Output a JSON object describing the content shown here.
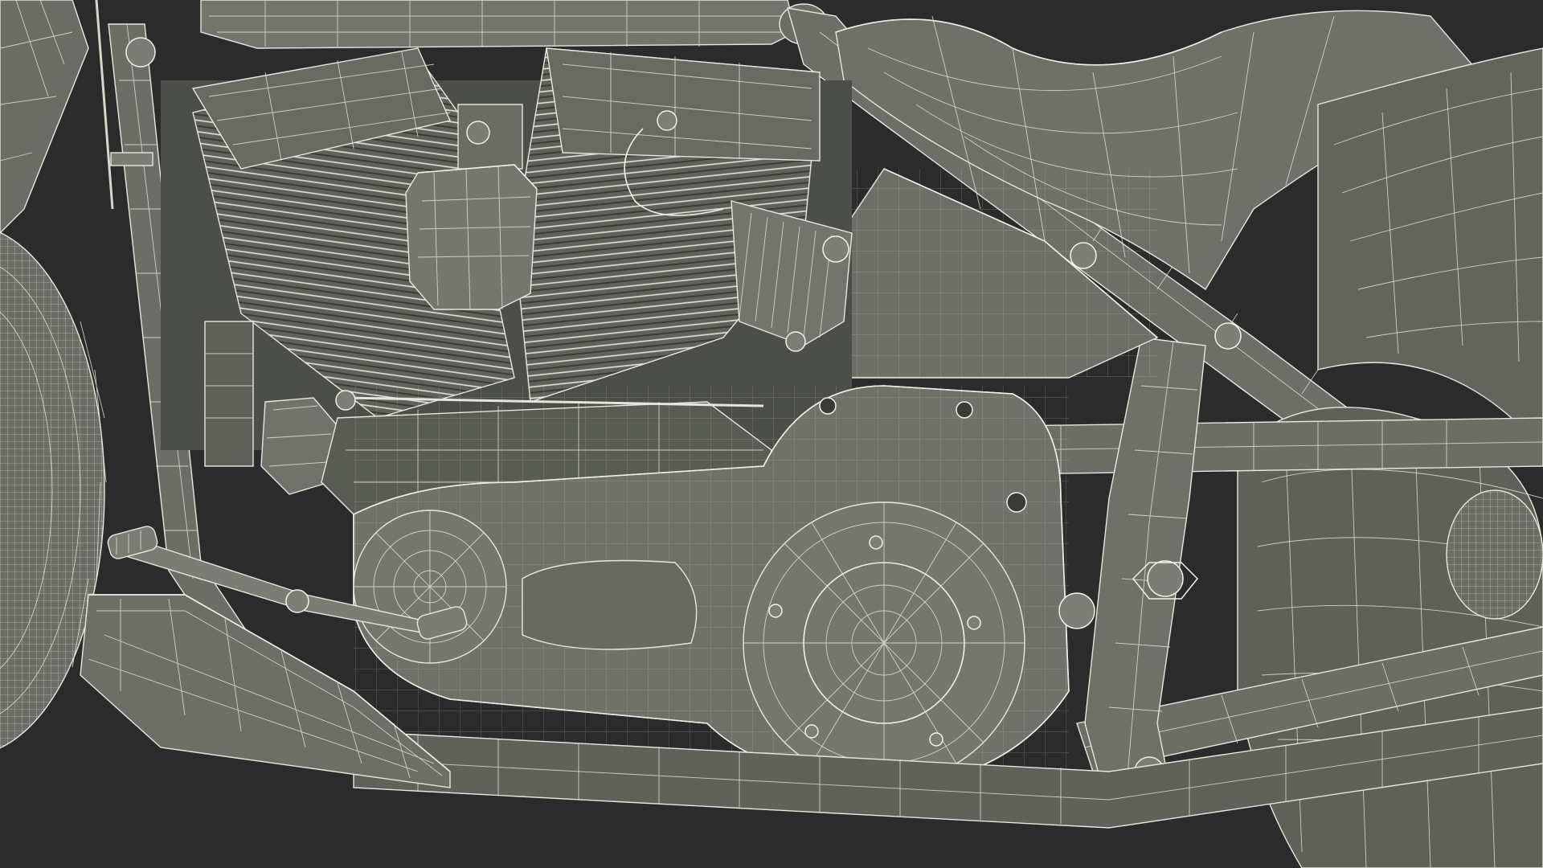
{
  "scene": {
    "subject": "motorcycle-wireframe-render",
    "render_mode": "wireframe-on-shaded",
    "colors": {
      "background": "#2b2b2b",
      "surface_dark": "#5a5c55",
      "surface_mid": "#6f716a",
      "surface_light": "#85877f",
      "wire": "#e3e3d6"
    },
    "components": [
      "front-tire",
      "front-fork",
      "fuel-tank",
      "seat",
      "frame",
      "v-twin-engine",
      "cylinder-fins",
      "air-cleaner-cover",
      "ignition-coil",
      "oil-tank",
      "primary-drive-cover",
      "clutch-cover",
      "foot-board",
      "shifter-pedal",
      "exhaust-pipe",
      "rear-fender",
      "rear-tire",
      "swing-arm"
    ]
  }
}
